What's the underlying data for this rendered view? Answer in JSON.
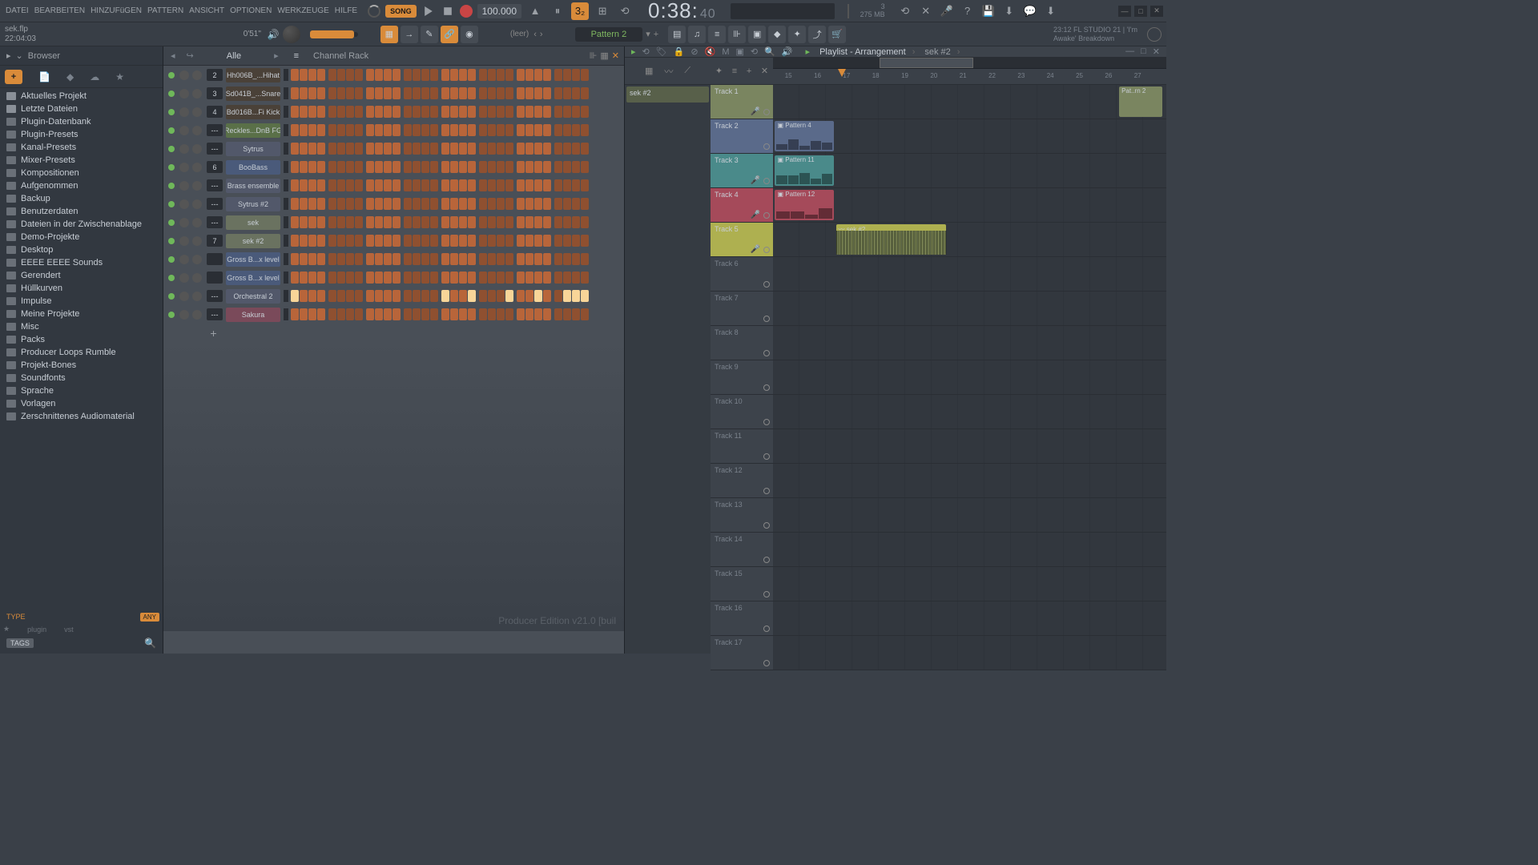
{
  "menu": [
    "DATEI",
    "BEARBEITEN",
    "HINZUFüGEN",
    "PATTERN",
    "ANSICHT",
    "OPTIONEN",
    "WERKZEUGE",
    "HILFE"
  ],
  "song_mode": "SONG",
  "tempo": "100.000",
  "time": {
    "main": "0:38:",
    "sub": "40"
  },
  "cpu": {
    "line1": "3",
    "line2": "275 MB",
    "line3": ""
  },
  "win_controls": [
    "—",
    "□",
    "✕"
  ],
  "hint": {
    "file": "sek.flp",
    "date": "22:04:03",
    "dur": "0'51\""
  },
  "pattern_sel": "Pattern 2",
  "empty_label": "(leer)",
  "project": {
    "line1": "23:12   FL STUDIO 21 | 'I'm",
    "line2": "Awake' Breakdown"
  },
  "browser": {
    "title": "Browser",
    "items": [
      "Aktuelles Projekt",
      "Letzte Dateien",
      "Plugin-Datenbank",
      "Plugin-Presets",
      "Kanal-Presets",
      "Mixer-Presets",
      "Kompositionen",
      "Aufgenommen",
      "Backup",
      "Benutzerdaten",
      "Dateien in der Zwischenablage",
      "Demo-Projekte",
      "Desktop",
      "EEEE EEEE Sounds",
      "Gerendert",
      "Hüllkurven",
      "Impulse",
      "Meine Projekte",
      "Misc",
      "Packs",
      "Producer Loops Rumble",
      "Projekt-Bones",
      "Soundfonts",
      "Sprache",
      "Vorlagen",
      "Zerschnittenes Audiomaterial"
    ],
    "type": "TYPE",
    "any": "ANY",
    "foot": [
      "★",
      "plugin",
      "vst"
    ],
    "tags": "TAGS"
  },
  "chrack": {
    "group": "Alle",
    "title": "Channel Rack",
    "add": "+",
    "channels": [
      {
        "route": "2",
        "name": "Hh006B_...Hihat",
        "color": "#4a4138"
      },
      {
        "route": "3",
        "name": "Sd041B_...Snare",
        "color": "#4a4138"
      },
      {
        "route": "4",
        "name": "Bd016B...Fi Kick",
        "color": "#4a4138"
      },
      {
        "route": "---",
        "name": "Reckles...DnB FG",
        "color": "#5a7048"
      },
      {
        "route": "---",
        "name": "Sytrus",
        "color": "#52586a"
      },
      {
        "route": "6",
        "name": "BooBass",
        "color": "#4a5a7a"
      },
      {
        "route": "---",
        "name": "Brass ensemble",
        "color": "#52586a"
      },
      {
        "route": "---",
        "name": "Sytrus #2",
        "color": "#52586a"
      },
      {
        "route": "---",
        "name": "sek",
        "color": "#6a7260"
      },
      {
        "route": "7",
        "name": "sek #2",
        "color": "#6a7260"
      },
      {
        "route": "",
        "name": "Gross B...x level",
        "color": "#4a5a7a"
      },
      {
        "route": "",
        "name": "Gross B...x level",
        "color": "#4a5a7a"
      },
      {
        "route": "---",
        "name": "Orchestral 2",
        "color": "#52586a",
        "lit": [
          0,
          16,
          19,
          23,
          26,
          29,
          30,
          31
        ]
      },
      {
        "route": "---",
        "name": "Sakura",
        "color": "#7a4a5a"
      }
    ],
    "edition": "Producer Edition v21.0 [buil"
  },
  "playlist": {
    "title": "Playlist - Arrangement",
    "crumb": "sek #2",
    "picker": "sek #2",
    "bars": [
      "15",
      "16",
      "17",
      "18",
      "19",
      "20",
      "21",
      "22",
      "23",
      "24",
      "25",
      "26",
      "27"
    ],
    "tracks": [
      {
        "label": "Track 1",
        "cls": "t1",
        "mic": true
      },
      {
        "label": "Track 2",
        "cls": "t2"
      },
      {
        "label": "Track 3",
        "cls": "t3",
        "mic": true
      },
      {
        "label": "Track 4",
        "cls": "t4",
        "mic": true
      },
      {
        "label": "Track 5",
        "cls": "t5",
        "mic": true
      },
      {
        "label": "Track 6",
        "cls": "tn"
      },
      {
        "label": "Track 7",
        "cls": "tn"
      },
      {
        "label": "Track 8",
        "cls": "tn"
      },
      {
        "label": "Track 9",
        "cls": "tn"
      },
      {
        "label": "Track 10",
        "cls": "tn"
      },
      {
        "label": "Track 11",
        "cls": "tn"
      },
      {
        "label": "Track 12",
        "cls": "tn"
      },
      {
        "label": "Track 13",
        "cls": "tn"
      },
      {
        "label": "Track 14",
        "cls": "tn"
      },
      {
        "label": "Track 15",
        "cls": "tn"
      },
      {
        "label": "Track 16",
        "cls": "tn"
      },
      {
        "label": "Track 17",
        "cls": "tn"
      }
    ],
    "clips": {
      "pat_rn": "Pat..rn 2",
      "p4": "Pattern 4",
      "p11": "Pattern 11",
      "p12": "Pattern 12",
      "sek2": "sek #2"
    }
  }
}
